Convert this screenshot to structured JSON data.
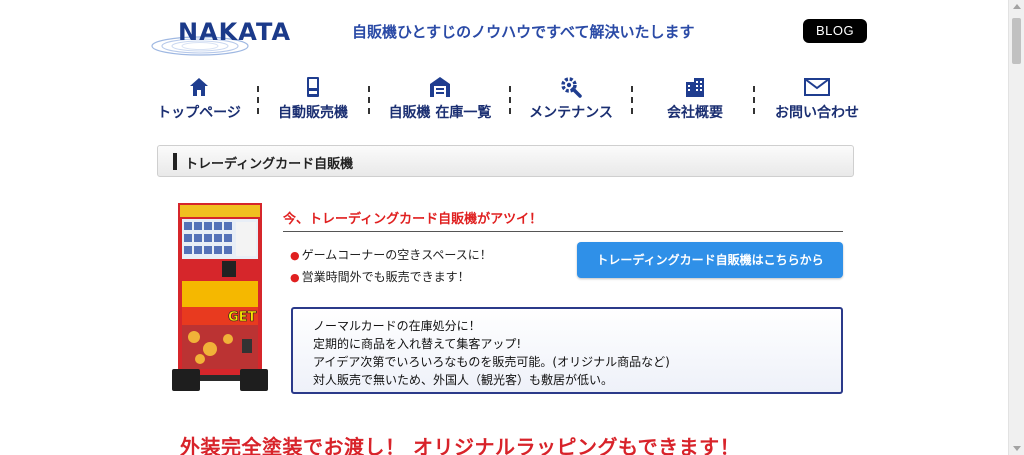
{
  "header": {
    "logo_text": "NAKATA",
    "tagline": "自販機ひとすじのノウハウですべて解決いたします",
    "blog_label": "BLOG"
  },
  "nav": {
    "items": [
      {
        "label": "トップページ",
        "icon": "home-icon"
      },
      {
        "label": "自動販売機",
        "icon": "vending-icon"
      },
      {
        "label": "自販機 在庫一覧",
        "icon": "warehouse-icon"
      },
      {
        "label": "メンテナンス",
        "icon": "gear-wrench-icon"
      },
      {
        "label": "会社概要",
        "icon": "building-icon"
      },
      {
        "label": "お問い合わせ",
        "icon": "mail-icon"
      }
    ]
  },
  "section": {
    "title": "トレーディングカード自販機"
  },
  "content": {
    "headline": "今、トレーディングカード自販機がアツイ！",
    "bullets": [
      "ゲームコーナーの空きスペースに！",
      "営業時間外でも販売できます！"
    ],
    "cta_label": "トレーディングカード自販機はこちらから",
    "info_lines": [
      "ノーマルカードの在庫処分に！",
      "定期的に商品を入れ替えて集客アップ!",
      "アイデア次第でいろいろなものを販売可能。(オリジナル商品など)",
      "対人販売で無いため、外国人（観光客）も敷居が低い。"
    ],
    "vm_sign": "GET",
    "banner": "外装完全塗装でお渡し！ オリジナルラッピングもできます！"
  },
  "colors": {
    "brand_navy": "#1b3a8a",
    "accent_red": "#e02020",
    "cta_blue": "#2f90e8",
    "nav_icon": "#1f3d8f"
  }
}
